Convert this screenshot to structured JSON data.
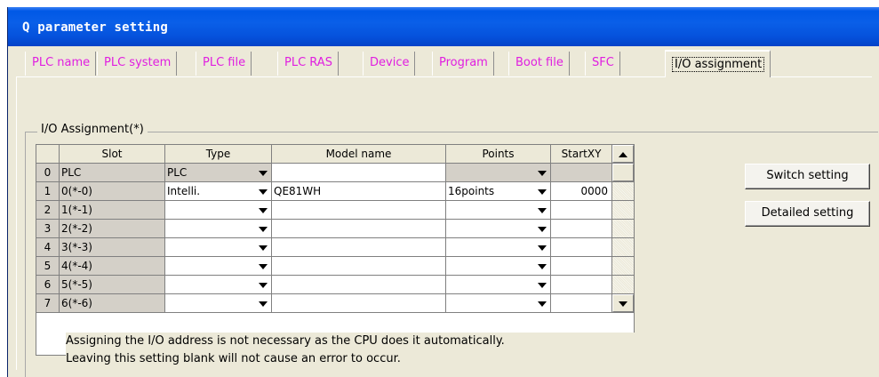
{
  "window": {
    "title": "Q parameter setting"
  },
  "tabs": [
    {
      "label": "PLC name",
      "active": false
    },
    {
      "label": "PLC system",
      "active": false
    },
    {
      "label": "PLC file",
      "active": false
    },
    {
      "label": "PLC RAS",
      "active": false
    },
    {
      "label": "Device",
      "active": false
    },
    {
      "label": "Program",
      "active": false
    },
    {
      "label": "Boot file",
      "active": false
    },
    {
      "label": "SFC",
      "active": false
    },
    {
      "label": "I/O assignment",
      "active": true
    }
  ],
  "group": {
    "label": "I/O Assignment(*)"
  },
  "table": {
    "headers": {
      "no": "",
      "slot": "Slot",
      "type": "Type",
      "model": "Model name",
      "points": "Points",
      "start": "StartXY"
    },
    "rows": [
      {
        "no": "0",
        "slot": "PLC",
        "type": "PLC",
        "model": "",
        "points": "",
        "start": ""
      },
      {
        "no": "1",
        "slot": "0(*-0)",
        "type": "Intelli.",
        "model": "QE81WH",
        "points": "16points",
        "start": "0000"
      },
      {
        "no": "2",
        "slot": "1(*-1)",
        "type": "",
        "model": "",
        "points": "",
        "start": ""
      },
      {
        "no": "3",
        "slot": "2(*-2)",
        "type": "",
        "model": "",
        "points": "",
        "start": ""
      },
      {
        "no": "4",
        "slot": "3(*-3)",
        "type": "",
        "model": "",
        "points": "",
        "start": ""
      },
      {
        "no": "5",
        "slot": "4(*-4)",
        "type": "",
        "model": "",
        "points": "",
        "start": ""
      },
      {
        "no": "6",
        "slot": "5(*-5)",
        "type": "",
        "model": "",
        "points": "",
        "start": ""
      },
      {
        "no": "7",
        "slot": "6(*-6)",
        "type": "",
        "model": "",
        "points": "",
        "start": ""
      }
    ]
  },
  "notes": {
    "line1": "Assigning the I/O address is not necessary as the CPU does it automatically.",
    "line2": "Leaving this setting blank will not cause an error to occur."
  },
  "buttons": {
    "switch": "Switch setting",
    "detailed": "Detailed setting"
  }
}
